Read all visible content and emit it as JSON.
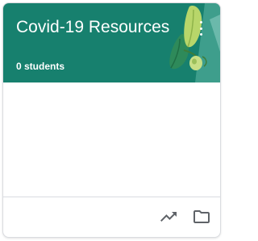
{
  "class_card": {
    "title": "Covid-19 Resources",
    "student_count": "0 students",
    "banner_color": "#17806e",
    "menu_icon": "more-vert-icon",
    "footer_icons": [
      "trending-up-icon",
      "folder-icon"
    ]
  }
}
